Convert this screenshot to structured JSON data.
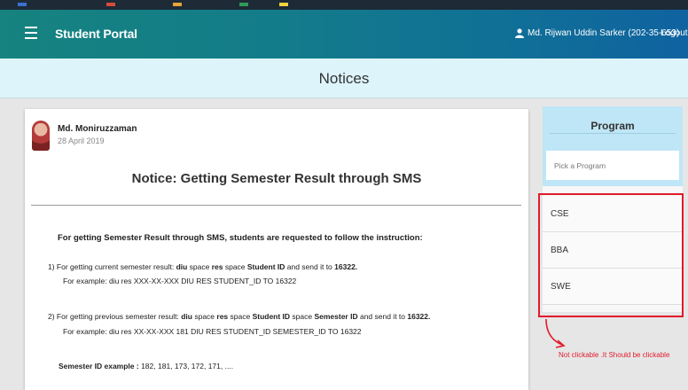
{
  "colors": {
    "accent": "#137c8a",
    "annotation": "#e11b2b",
    "notice_bar": "#dcf4fa",
    "sidebar_head": "#bfe6f6"
  },
  "navbar": {
    "menu_icon": "hamburger-icon",
    "brand": "Student Portal",
    "user_icon": "user-icon",
    "user_name": "Md. Rijwan Uddin Sarker (202-35-653)",
    "logout": "Logout"
  },
  "page": {
    "heading": "Notices"
  },
  "notice": {
    "author": "Md. Moniruzzaman",
    "date": "28 April 2019",
    "title": "Notice: Getting Semester Result through SMS",
    "intro": "For getting Semester Result through SMS, students are requested to follow the instruction:",
    "item1": {
      "prefix": "1)  For getting current semester result: ",
      "cmd1": "diu",
      "t1": " space ",
      "cmd2": "res",
      "t2": " space ",
      "cmd3": "Student ID",
      "t3": " and send it to ",
      "cmd4": "16322.",
      "example": "For example: diu res XXX-XX-XXX DIU RES STUDENT_ID TO 16322"
    },
    "item2": {
      "prefix": "2) For getting previous semester result: ",
      "cmd1": "diu",
      "t1": " space ",
      "cmd2": "res",
      "t2": " space ",
      "cmd3": "Student ID",
      "t3": " space ",
      "cmd4": "Semester ID",
      "t4": " and send it to ",
      "cmd5": "16322.",
      "example": "For example: diu res XX-XX-XXX 181 DIU RES STUDENT_ID SEMESTER_ID TO 16322"
    },
    "semester_label": "Semester ID example : ",
    "semester_values": "182, 181, 173, 172, 171, ...."
  },
  "sidebar": {
    "title": "Program",
    "picker_placeholder": "Pick a Program",
    "programs": [
      "CSE",
      "BBA",
      "SWE"
    ]
  },
  "annotation": {
    "text": "Not clickable .It Should be clickable"
  }
}
